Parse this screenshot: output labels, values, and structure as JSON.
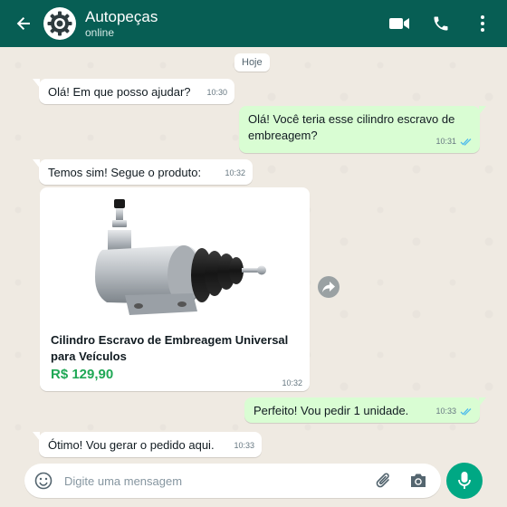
{
  "header": {
    "contact_name": "Autopeças",
    "status": "online",
    "icons": [
      "back-arrow-icon",
      "video-call-icon",
      "phone-icon",
      "more-options-icon"
    ]
  },
  "chat": {
    "date_chip": "Hoje",
    "messages": [
      {
        "direction": "in",
        "text": "Olá! Em que posso ajudar?",
        "time": "10:30"
      },
      {
        "direction": "out",
        "text": "Olá! Você teria esse cilindro escravo de embreagem?",
        "time": "10:31",
        "read": true
      },
      {
        "direction": "in",
        "text": "Temos sim! Segue o produto:",
        "time": "10:32"
      },
      {
        "direction": "out",
        "text": "Perfeito! Vou pedir 1 unidade.",
        "time": "10:33",
        "read": true
      },
      {
        "direction": "in",
        "text": "Ótimo! Vou gerar o pedido aqui.",
        "time": "10:33"
      }
    ],
    "product": {
      "title": "Cilindro Escravo de Embreagem Universal para Veículos",
      "price": "R$ 129,90",
      "time": "10:32"
    }
  },
  "composer": {
    "placeholder": "Digite uma mensagem",
    "value": ""
  },
  "colors": {
    "header": "#075e54",
    "outgoing_bubble": "#d9fdd3",
    "incoming_bubble": "#ffffff",
    "price": "#1fa855",
    "read_ticks": "#53bdeb",
    "mic_button": "#00a884"
  }
}
